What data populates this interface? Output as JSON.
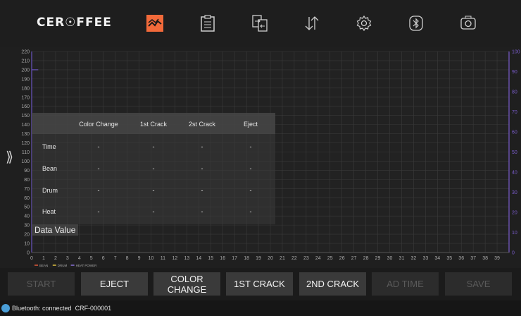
{
  "brand": {
    "logo_text": "CER☉FFEE"
  },
  "nav": [
    {
      "icon": "chart-icon",
      "active": true
    },
    {
      "icon": "clipboard-icon",
      "active": false
    },
    {
      "icon": "file-transfer-icon",
      "active": false
    },
    {
      "icon": "sort-arrows-icon",
      "active": false
    },
    {
      "icon": "gear-icon",
      "active": false
    },
    {
      "icon": "bluetooth-icon",
      "active": false
    },
    {
      "icon": "camera-icon",
      "active": false
    }
  ],
  "chart_data": {
    "type": "line",
    "x_ticks": [
      "0",
      "1",
      "2",
      "3",
      "4",
      "5",
      "6",
      "7",
      "8",
      "9",
      "10",
      "11",
      "12",
      "13",
      "14",
      "15",
      "16",
      "17",
      "18",
      "19",
      "20",
      "21",
      "22",
      "23",
      "24",
      "25",
      "26",
      "27",
      "28",
      "29",
      "30",
      "31",
      "32",
      "33",
      "34",
      "35",
      "36",
      "37",
      "38",
      "39"
    ],
    "y_left_ticks": [
      "0",
      "10",
      "20",
      "30",
      "40",
      "50",
      "60",
      "70",
      "80",
      "90",
      "100",
      "110",
      "120",
      "130",
      "140",
      "150",
      "160",
      "170",
      "180",
      "190",
      "200",
      "210",
      "220"
    ],
    "y_right_ticks": [
      "0",
      "10",
      "20",
      "30",
      "40",
      "50",
      "60",
      "70",
      "80",
      "90",
      "100"
    ],
    "ylim_left": [
      0,
      220
    ],
    "ylim_right": [
      0,
      100
    ],
    "xlim": [
      0,
      40
    ],
    "legend": [
      "BEAN",
      "DRUM",
      "HEAT POWER"
    ],
    "legend_colors": [
      "#e05a3a",
      "#e0c040",
      "#8a70d8"
    ],
    "grid": true,
    "series": [
      {
        "name": "BEAN",
        "values": []
      },
      {
        "name": "DRUM",
        "values": []
      },
      {
        "name": "HEAT POWER",
        "values": []
      }
    ]
  },
  "data_panel": {
    "columns": [
      "Color Change",
      "1st Crack",
      "2st Crack",
      "Eject"
    ],
    "rows": [
      {
        "label": "Time",
        "values": [
          "-",
          "-",
          "-",
          "-"
        ]
      },
      {
        "label": "Bean",
        "values": [
          "-",
          "-",
          "-",
          "-"
        ]
      },
      {
        "label": "Drum",
        "values": [
          "-",
          "-",
          "-",
          "-"
        ]
      },
      {
        "label": "Heat",
        "values": [
          "-",
          "-",
          "-",
          "-"
        ]
      }
    ],
    "caption": "Data Value"
  },
  "buttons": [
    {
      "label": "START",
      "enabled": false
    },
    {
      "label": "EJECT",
      "enabled": true
    },
    {
      "label": "COLOR CHANGE",
      "enabled": true
    },
    {
      "label": "1ST CRACK",
      "enabled": true
    },
    {
      "label": "2ND CRACK",
      "enabled": true
    },
    {
      "label": "AD TIME",
      "enabled": false
    },
    {
      "label": "SAVE",
      "enabled": false
    }
  ],
  "status": {
    "text": "Bluetooth: connected  CRF-000001"
  },
  "colors": {
    "accent": "#f26a3a",
    "axis_right": "#7a5ccc",
    "grid": "#3a3a3a"
  }
}
